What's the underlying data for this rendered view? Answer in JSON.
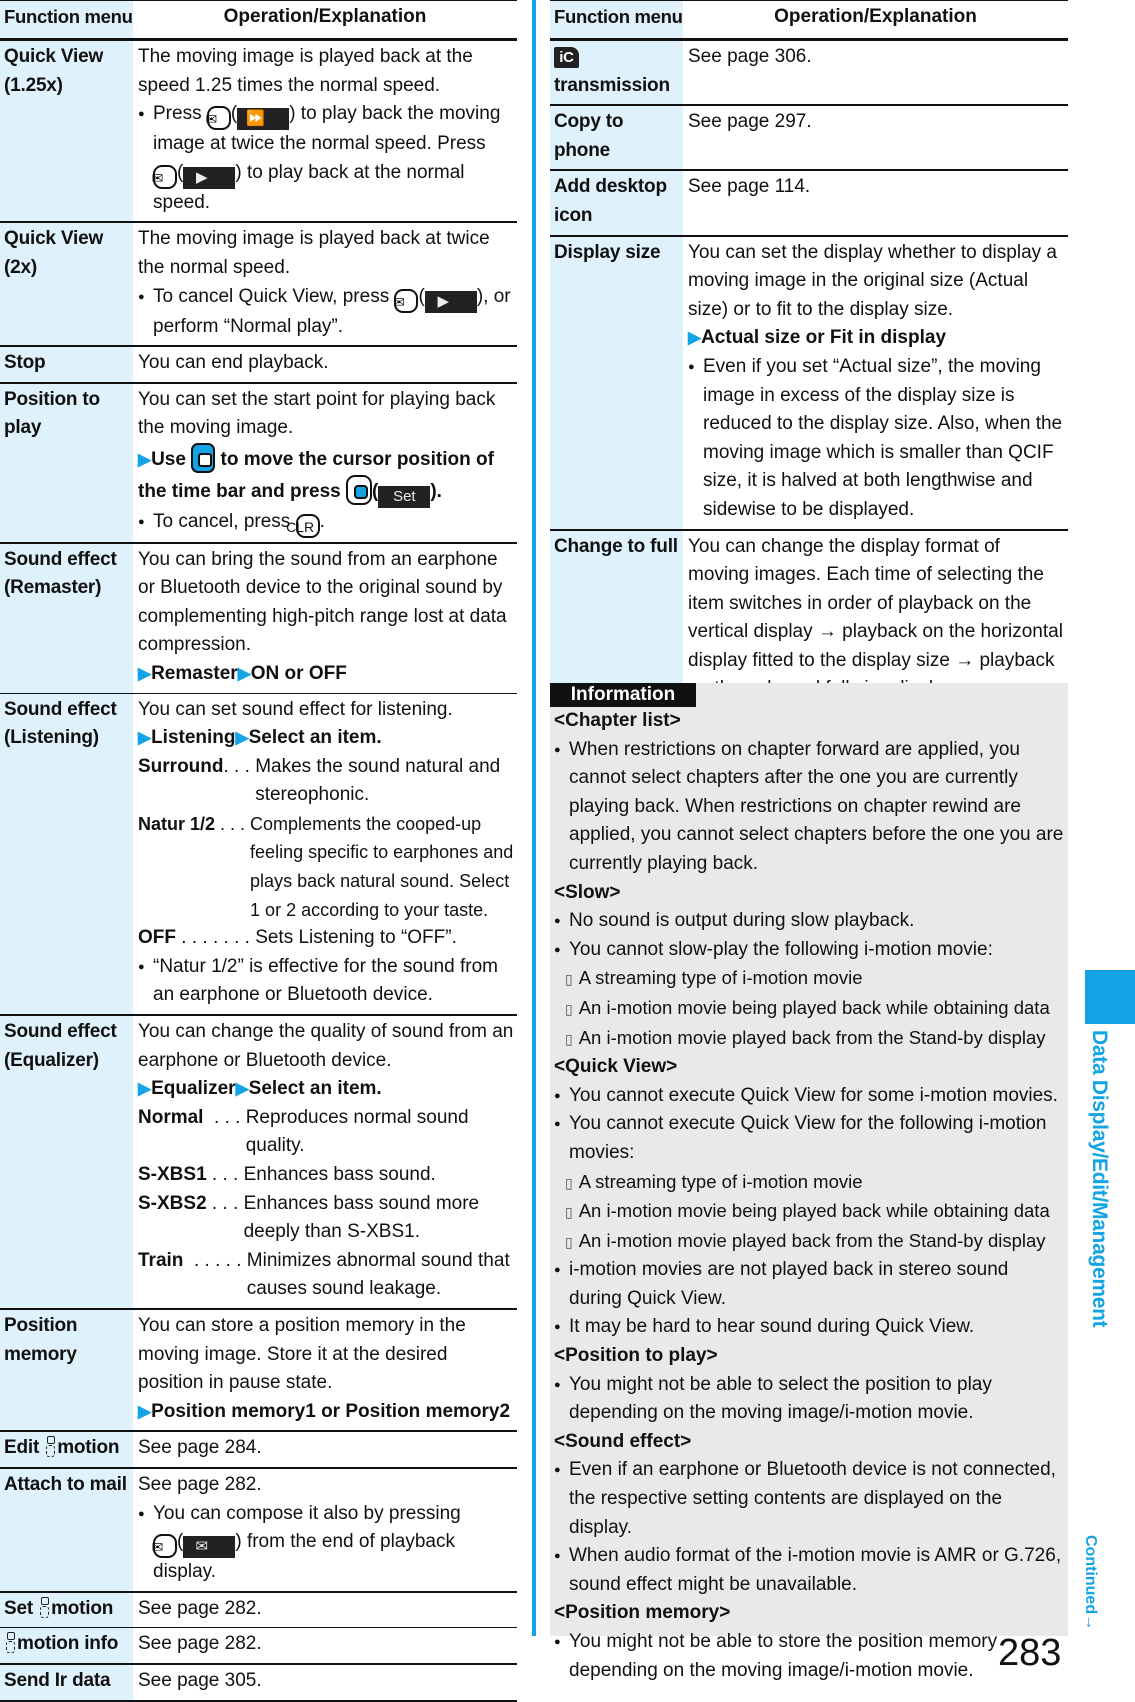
{
  "left_table": {
    "headers": {
      "function": "Function menu",
      "operation": "Operation/Explanation"
    },
    "rows": [
      {
        "name": "Quick View (1.25x)",
        "desc": "The moving image is played back at the speed 1.25 times the normal speed.",
        "bullet_a": {
          "pre": "Press",
          "softkey": "⏩",
          "post": "to play back the moving image at twice the normal speed. Press"
        },
        "bullet_b": {
          "softkey": "▶",
          "post": "to play back at the normal speed."
        }
      },
      {
        "name": "Quick View (2x)",
        "desc": "The moving image is played back at twice the normal speed.",
        "bullet": {
          "pre": "To cancel Quick View, press",
          "softkey": "▶",
          "post": ", or perform “Normal play”."
        }
      },
      {
        "name": "Stop",
        "desc": "You can end playback."
      },
      {
        "name": "Position to play",
        "desc": "You can set the start point for playing back the moving image.",
        "step": {
          "pre": "Use",
          "mid": "to move the cursor position of the time bar and press",
          "softkey": "Set"
        },
        "bullet": {
          "pre": "To cancel, press",
          "key": "CLR"
        }
      },
      {
        "name": "Sound effect (Remaster)",
        "desc": "You can bring the sound from an earphone or Bluetooth device to the original sound by complementing high-pitch range lost at data compression.",
        "steps": [
          "Remaster",
          "ON or OFF"
        ]
      },
      {
        "name": "Sound effect (Listening)",
        "desc": "You can set sound effect for listening.",
        "steps": [
          "Listening",
          "Select an item."
        ],
        "defs": [
          {
            "k": "Surround",
            "dots": ". . . ",
            "v": "Makes the sound natural and stereophonic."
          },
          {
            "k": "Natur 1/2",
            "dots": " . . . ",
            "v": "Complements the cooped-up feeling specific to earphones and plays back natural sound. Select 1 or 2 according to your taste."
          },
          {
            "k": "OFF",
            "dots": " . . . . . . . ",
            "v": "Sets Listening to “OFF”."
          }
        ],
        "bullet": "“Natur 1/2” is effective for the sound from an earphone or Bluetooth device."
      },
      {
        "name": "Sound effect (Equalizer)",
        "desc": "You can change the quality of sound from an earphone or Bluetooth device.",
        "steps": [
          "Equalizer",
          "Select an item."
        ],
        "defs": [
          {
            "k": "Normal",
            "dots": "  . . . ",
            "v": "Reproduces normal sound quality."
          },
          {
            "k": "S-XBS1",
            "dots": " . . . ",
            "v": "Enhances bass sound."
          },
          {
            "k": "S-XBS2",
            "dots": " . . . ",
            "v": "Enhances bass sound more deeply than S-XBS1."
          },
          {
            "k": "Train",
            "dots": "  . . . . . ",
            "v": "Minimizes abnormal sound that causes sound leakage."
          }
        ]
      },
      {
        "name": "Position memory",
        "desc": "You can store a position memory in the moving image. Store it at the desired position in pause state.",
        "steps": [
          "Position memory1 or Position memory2"
        ]
      },
      {
        "name_pre": "Edit",
        "name_post": "motion",
        "desc": "See page 284."
      },
      {
        "name": "Attach to mail",
        "desc": "See page 282.",
        "bullet": {
          "pre": "You can compose it also by pressing",
          "softkey": "✉",
          "post": "from the end of playback display."
        }
      },
      {
        "name_pre": "Set",
        "name_post": "motion",
        "desc": "See page 282."
      },
      {
        "name_pre": "",
        "name_post": "motion info",
        "desc": "See page 282."
      },
      {
        "name": "Send Ir data",
        "desc": "See page 305."
      }
    ]
  },
  "right_table": {
    "headers": {
      "function": "Function menu",
      "operation": "Operation/Explanation"
    },
    "rows": [
      {
        "icon": "iC",
        "name": "transmission",
        "desc": "See page 306."
      },
      {
        "name": "Copy to phone",
        "desc": "See page 297."
      },
      {
        "name": "Add desktop icon",
        "desc": "See page 114."
      },
      {
        "name": "Display size",
        "desc": "You can set the display whether to display a moving image in the original size (Actual size) or to fit to the display size.",
        "steps": [
          "Actual size or Fit in display"
        ],
        "bullet": "Even if you set “Actual size”, the moving image in excess of the display size is reduced to the display size. Also, when the moving image which is smaller than QCIF size, it is halved at both lengthwise and sidewise to be displayed."
      },
      {
        "name": "Change to full",
        "desc": "You can change the display format of moving images. Each time of selecting the item switches in order of playback on the vertical display → playback on the horizontal display fitted to the display size → playback on the enlarged full size display."
      }
    ]
  },
  "information": {
    "label": "Information",
    "sections": [
      {
        "title": "<Chapter list>",
        "items": [
          {
            "type": "bullet",
            "text": "When restrictions on chapter forward are applied, you cannot select chapters after the one you are currently playing back. When restrictions on chapter rewind are applied, you cannot select chapters before the one you are currently playing back."
          }
        ]
      },
      {
        "title": "<Slow>",
        "items": [
          {
            "type": "bullet",
            "text": "No sound is output during slow playback."
          },
          {
            "type": "bullet",
            "text": "You cannot slow-play the following i-motion movie:"
          },
          {
            "type": "sub",
            "text": "A streaming type of i-motion movie"
          },
          {
            "type": "sub",
            "text": "An i-motion movie being played back while obtaining data"
          },
          {
            "type": "sub",
            "text": "An i-motion movie played back from the Stand-by display"
          }
        ]
      },
      {
        "title": "<Quick View>",
        "items": [
          {
            "type": "bullet",
            "text": "You cannot execute Quick View for some i-motion movies."
          },
          {
            "type": "bullet",
            "text": "You cannot execute Quick View for the following i-motion movies:"
          },
          {
            "type": "sub",
            "text": "A streaming type of i-motion movie"
          },
          {
            "type": "sub",
            "text": "An i-motion movie being played back while obtaining data"
          },
          {
            "type": "sub",
            "text": "An i-motion movie played back from the Stand-by display"
          },
          {
            "type": "bullet",
            "text": "i-motion movies are not played back in stereo sound during Quick View."
          },
          {
            "type": "bullet",
            "text": "It may be hard to hear sound during Quick View."
          }
        ]
      },
      {
        "title": "<Position to play>",
        "items": [
          {
            "type": "bullet",
            "text": "You might not be able to select the position to play depending on the moving image/i-motion movie."
          }
        ]
      },
      {
        "title": "<Sound effect>",
        "items": [
          {
            "type": "bullet",
            "text": "Even if an earphone or Bluetooth device is not connected, the respective setting contents are displayed on the display."
          },
          {
            "type": "bullet",
            "text": "When audio format of the i-motion movie is AMR or G.726, sound effect might be unavailable."
          }
        ]
      },
      {
        "title": "<Position memory>",
        "items": [
          {
            "type": "bullet",
            "text": "You might not be able to store the position memory depending on the moving image/i-motion movie."
          }
        ]
      }
    ]
  },
  "side_tab": {
    "label": "Data Display/Edit/Management",
    "color": "#12a4e4"
  },
  "continued": "Continued→",
  "page_number": "283"
}
